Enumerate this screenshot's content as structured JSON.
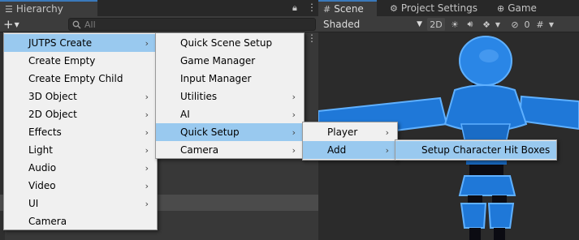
{
  "hierarchy": {
    "tab_label": "Hierarchy",
    "search_placeholder": "All"
  },
  "scene": {
    "tabs": [
      "Scene",
      "Project Settings",
      "Game"
    ],
    "shading_mode": "Shaded",
    "mode_2d": "2D",
    "hidden_count": "0"
  },
  "menus": {
    "main": [
      {
        "label": "JUTPS Create",
        "submenu": true,
        "selected": true
      },
      {
        "label": "Create Empty"
      },
      {
        "label": "Create Empty Child"
      },
      {
        "label": "3D Object",
        "submenu": true
      },
      {
        "label": "2D Object",
        "submenu": true
      },
      {
        "label": "Effects",
        "submenu": true
      },
      {
        "label": "Light",
        "submenu": true
      },
      {
        "label": "Audio",
        "submenu": true
      },
      {
        "label": "Video",
        "submenu": true
      },
      {
        "label": "UI",
        "submenu": true
      },
      {
        "label": "Camera"
      }
    ],
    "jutps": [
      {
        "label": "Quick Scene Setup"
      },
      {
        "label": "Game Manager"
      },
      {
        "label": "Input Manager"
      },
      {
        "label": "Utilities",
        "submenu": true
      },
      {
        "label": "AI",
        "submenu": true
      },
      {
        "label": "Quick Setup",
        "submenu": true,
        "selected": true
      },
      {
        "label": "Camera",
        "submenu": true
      }
    ],
    "quick_setup": [
      {
        "label": "Player",
        "submenu": true
      },
      {
        "label": "Add",
        "submenu": true,
        "selected": true
      }
    ],
    "add": [
      {
        "label": "Setup Character Hit Boxes",
        "selected": true
      }
    ]
  },
  "colors": {
    "menu_bg": "#f0f0f0",
    "menu_highlight": "#99c9ef",
    "character_blue": "#1f78d8",
    "character_black": "#0b0b12",
    "viewport_bg": "#2b2b2b"
  },
  "icons": {
    "hierarchy": "list-icon",
    "scene": "hash-icon",
    "project_settings": "gear-icon",
    "game": "gamepad-icon",
    "lock": "lock-icon",
    "menu": "kebab-icon"
  }
}
